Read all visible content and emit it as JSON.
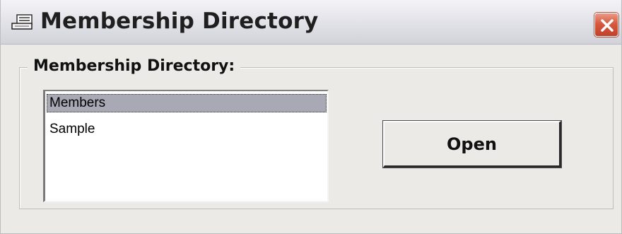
{
  "window": {
    "title": "Membership Directory"
  },
  "titlebar": {
    "app_icon": "notepad-icon",
    "close_icon": "close-x-icon"
  },
  "group": {
    "legend": "Membership Directory:"
  },
  "listbox": {
    "items": [
      {
        "label": "Members",
        "selected": true
      },
      {
        "label": "Sample",
        "selected": false
      }
    ]
  },
  "buttons": {
    "open_label": "Open"
  },
  "colors": {
    "face": "#ebeae6",
    "selection": "#a9a8b5",
    "close_button": "#d65a3f"
  }
}
